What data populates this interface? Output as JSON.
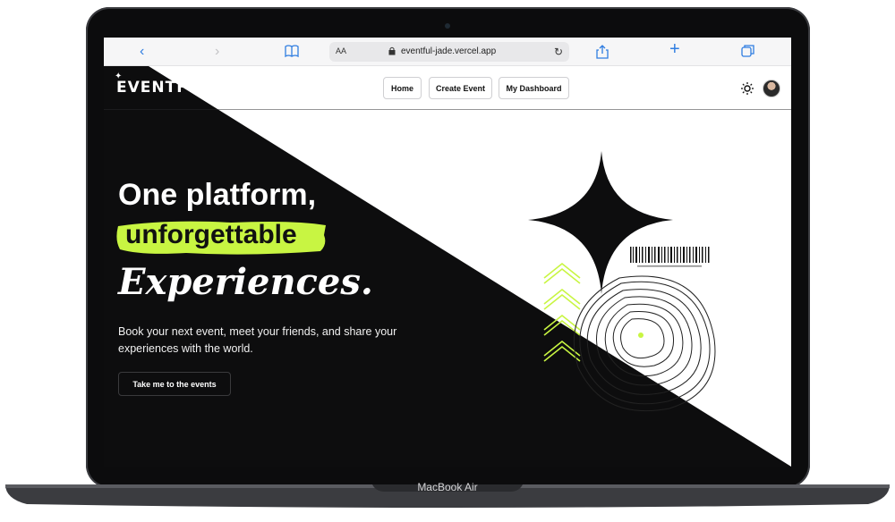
{
  "device": {
    "label": "MacBook Air"
  },
  "browser": {
    "url": "eventful-jade.vercel.app",
    "aa_label": "AA"
  },
  "nav": {
    "logo": "EVENTFUL",
    "items": [
      {
        "label": "Home"
      },
      {
        "label": "Create Event"
      },
      {
        "label": "My Dashboard"
      }
    ]
  },
  "hero": {
    "line1": "One platform,",
    "line2": "unforgettable",
    "line3": "Experiences.",
    "description": "Book your next event, meet your friends, and share your experiences with the world.",
    "cta_label": "Take me to the events"
  },
  "colors": {
    "accent": "#c8f542",
    "dark": "#0d0d0e",
    "light": "#ffffff",
    "browser_icon": "#2f7de1"
  }
}
